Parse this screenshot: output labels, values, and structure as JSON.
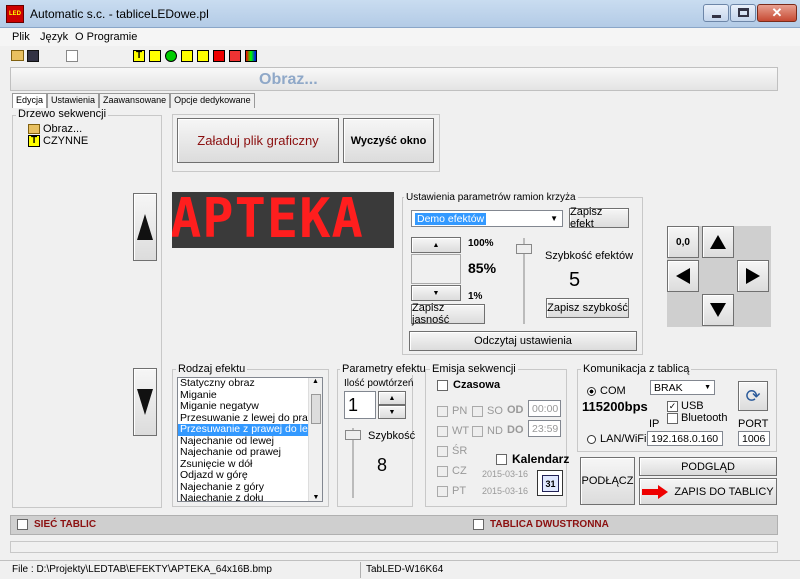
{
  "window": {
    "title": "Automatic s.c. - tabliceLEDowe.pl",
    "icon_text": "LED"
  },
  "menu": [
    "Plik",
    "Język",
    "O Programie"
  ],
  "toolbar_icons": [
    "open-icon",
    "save-icon",
    "blank-icon",
    "text-icon",
    "effects-icon",
    "smile-icon",
    "clock-icon",
    "sun-icon",
    "red-icon",
    "color-icon"
  ],
  "heading": "Obraz...",
  "tabs": [
    "Edycja",
    "Ustawienia",
    "Zaawansowane",
    "Opcje dedykowane"
  ],
  "tree": {
    "title": "Drzewo sekwencji",
    "items": [
      {
        "label": "Obraz..."
      },
      {
        "label": "CZYNNE"
      }
    ]
  },
  "buttons": {
    "load_image": "Załaduj plik graficzny",
    "clear": "Wyczyść okno"
  },
  "led_preview": "APTEKA",
  "frame_settings": {
    "title": "Ustawienia parametrów ramion krzyża",
    "effect_select": "Demo efektów",
    "save_effect": "Zapisz efekt",
    "brightness_max": "100%",
    "brightness_value": "85%",
    "brightness_min": "1%",
    "save_brightness": "Zapisz jasność",
    "speed_label": "Szybkość efektów",
    "speed_value": "5",
    "save_speed": "Zapisz szybkość",
    "read_settings": "Odczytaj ustawienia"
  },
  "nav_pad": {
    "label": "0,0"
  },
  "effect_kind": {
    "title": "Rodzaj efektu",
    "items": [
      "Statyczny obraz",
      "Miganie",
      "Miganie negatyw",
      "Przesuwanie z lewej do prawej",
      "Przesuwanie z prawej do lewej",
      "Najechanie od lewej",
      "Najechanie od prawej",
      "Zsunięcie w dół",
      "Odjazd w górę",
      "Najechanie z góry",
      "Najechanie z dołu"
    ],
    "selected_index": 4
  },
  "effect_params": {
    "title": "Parametry efektu",
    "repeat_label": "Ilość powtórzeń",
    "repeat_value": "1",
    "speed_label": "Szybkość",
    "speed_value": "8"
  },
  "emission": {
    "title": "Emisja sekwencji",
    "timed": "Czasowa",
    "days": [
      "PN",
      "SO",
      "WT",
      "ND",
      "ŚR",
      "CZ",
      "PT"
    ],
    "od_label": "OD",
    "od_value": "00:00",
    "do_label": "DO",
    "do_value": "23:59",
    "calendar": "Kalendarz",
    "date_from": "2015-03-16",
    "date_to": "2015-03-16",
    "calendar_icon_text": "31"
  },
  "communication": {
    "title": "Komunikacja z tablicą",
    "com_label": "COM",
    "com_select": "BRAK",
    "baud": "115200bps",
    "usb": "USB",
    "bluetooth": "Bluetooth",
    "lan_label": "LAN/WiFi",
    "ip_label": "IP",
    "ip_value": "192.168.0.160",
    "port_label": "PORT",
    "port_value": "1006"
  },
  "actions": {
    "connect": "PODŁĄCZ",
    "preview": "PODGLĄD",
    "write": "ZAPIS  DO TABLICY"
  },
  "bottom_bar": {
    "network": "SIEĆ TABLIC",
    "double_sided": "TABLICA DWUSTRONNA"
  },
  "status": {
    "file": "File : D:\\Projekty\\LEDTAB\\EFEKTY\\APTEKA_64x16B.bmp",
    "model": "TabLED-W16K64"
  },
  "colors": {
    "led_red": "#ff1e1e",
    "accent_red": "#8b1010",
    "title_blue": "#8fa8c8"
  }
}
